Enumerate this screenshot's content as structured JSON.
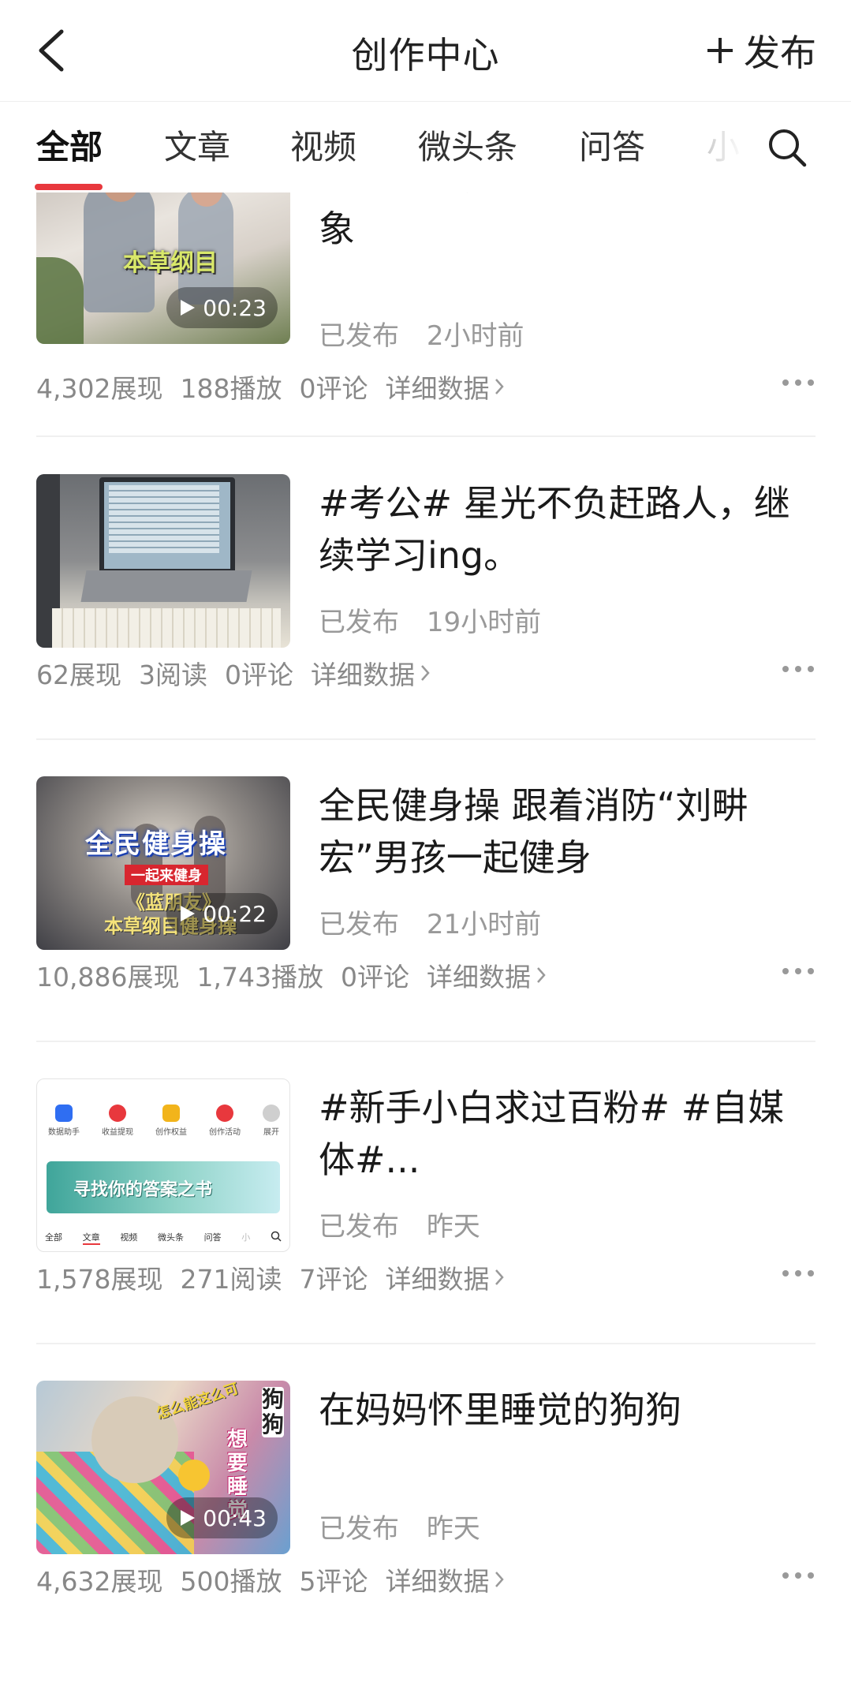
{
  "header": {
    "title": "创作中心",
    "publish_label": "发布"
  },
  "tabs": [
    {
      "label": "全部"
    },
    {
      "label": "文章"
    },
    {
      "label": "视频"
    },
    {
      "label": "微头条"
    },
    {
      "label": "问答"
    },
    {
      "label": "小"
    }
  ],
  "items": [
    {
      "title": "刘畊宏健身操出现“人传人”现象",
      "status": "已发布",
      "time": "2小时前",
      "stats": [
        "4,302展现",
        "188播放",
        "0评论"
      ],
      "detail_label": "详细数据",
      "thumb_text": "本草纲目",
      "duration": "00:23"
    },
    {
      "title": "#考公# 星光不负赶路人，继续学习ing。",
      "status": "已发布",
      "time": "19小时前",
      "stats": [
        "62展现",
        "3阅读",
        "0评论"
      ],
      "detail_label": "详细数据"
    },
    {
      "title": "全民健身操 跟着消防“刘畊宏”男孩一起健身",
      "status": "已发布",
      "time": "21小时前",
      "stats": [
        "10,886展现",
        "1,743播放",
        "0评论"
      ],
      "detail_label": "详细数据",
      "thumb_title": "全民健身操",
      "thumb_sub": "一起来健身",
      "thumb_line1": "《蓝朋友》",
      "thumb_line2": "本草纲目健身操",
      "duration": "00:22"
    },
    {
      "title": "#新手小白求过百粉# #自媒体#...",
      "status": "已发布",
      "time": "昨天",
      "stats": [
        "1,578展现",
        "271阅读",
        "7评论"
      ],
      "detail_label": "详细数据",
      "mini_icons": [
        "数据助手",
        "收益提现",
        "创作权益",
        "创作活动",
        "展开"
      ],
      "mini_banner": "寻找你的答案之书",
      "mini_tabs": [
        "全部",
        "文章",
        "视频",
        "微头条",
        "问答",
        "小"
      ]
    },
    {
      "title": "在妈妈怀里睡觉的狗狗",
      "status": "已发布",
      "time": "昨天",
      "stats": [
        "4,632展现",
        "500播放",
        "5评论"
      ],
      "detail_label": "详细数据",
      "thumb_side": "狗狗",
      "thumb_phrase": "怎么能这么可",
      "thumb_want": "想要睡觉",
      "duration": "00:43"
    }
  ]
}
